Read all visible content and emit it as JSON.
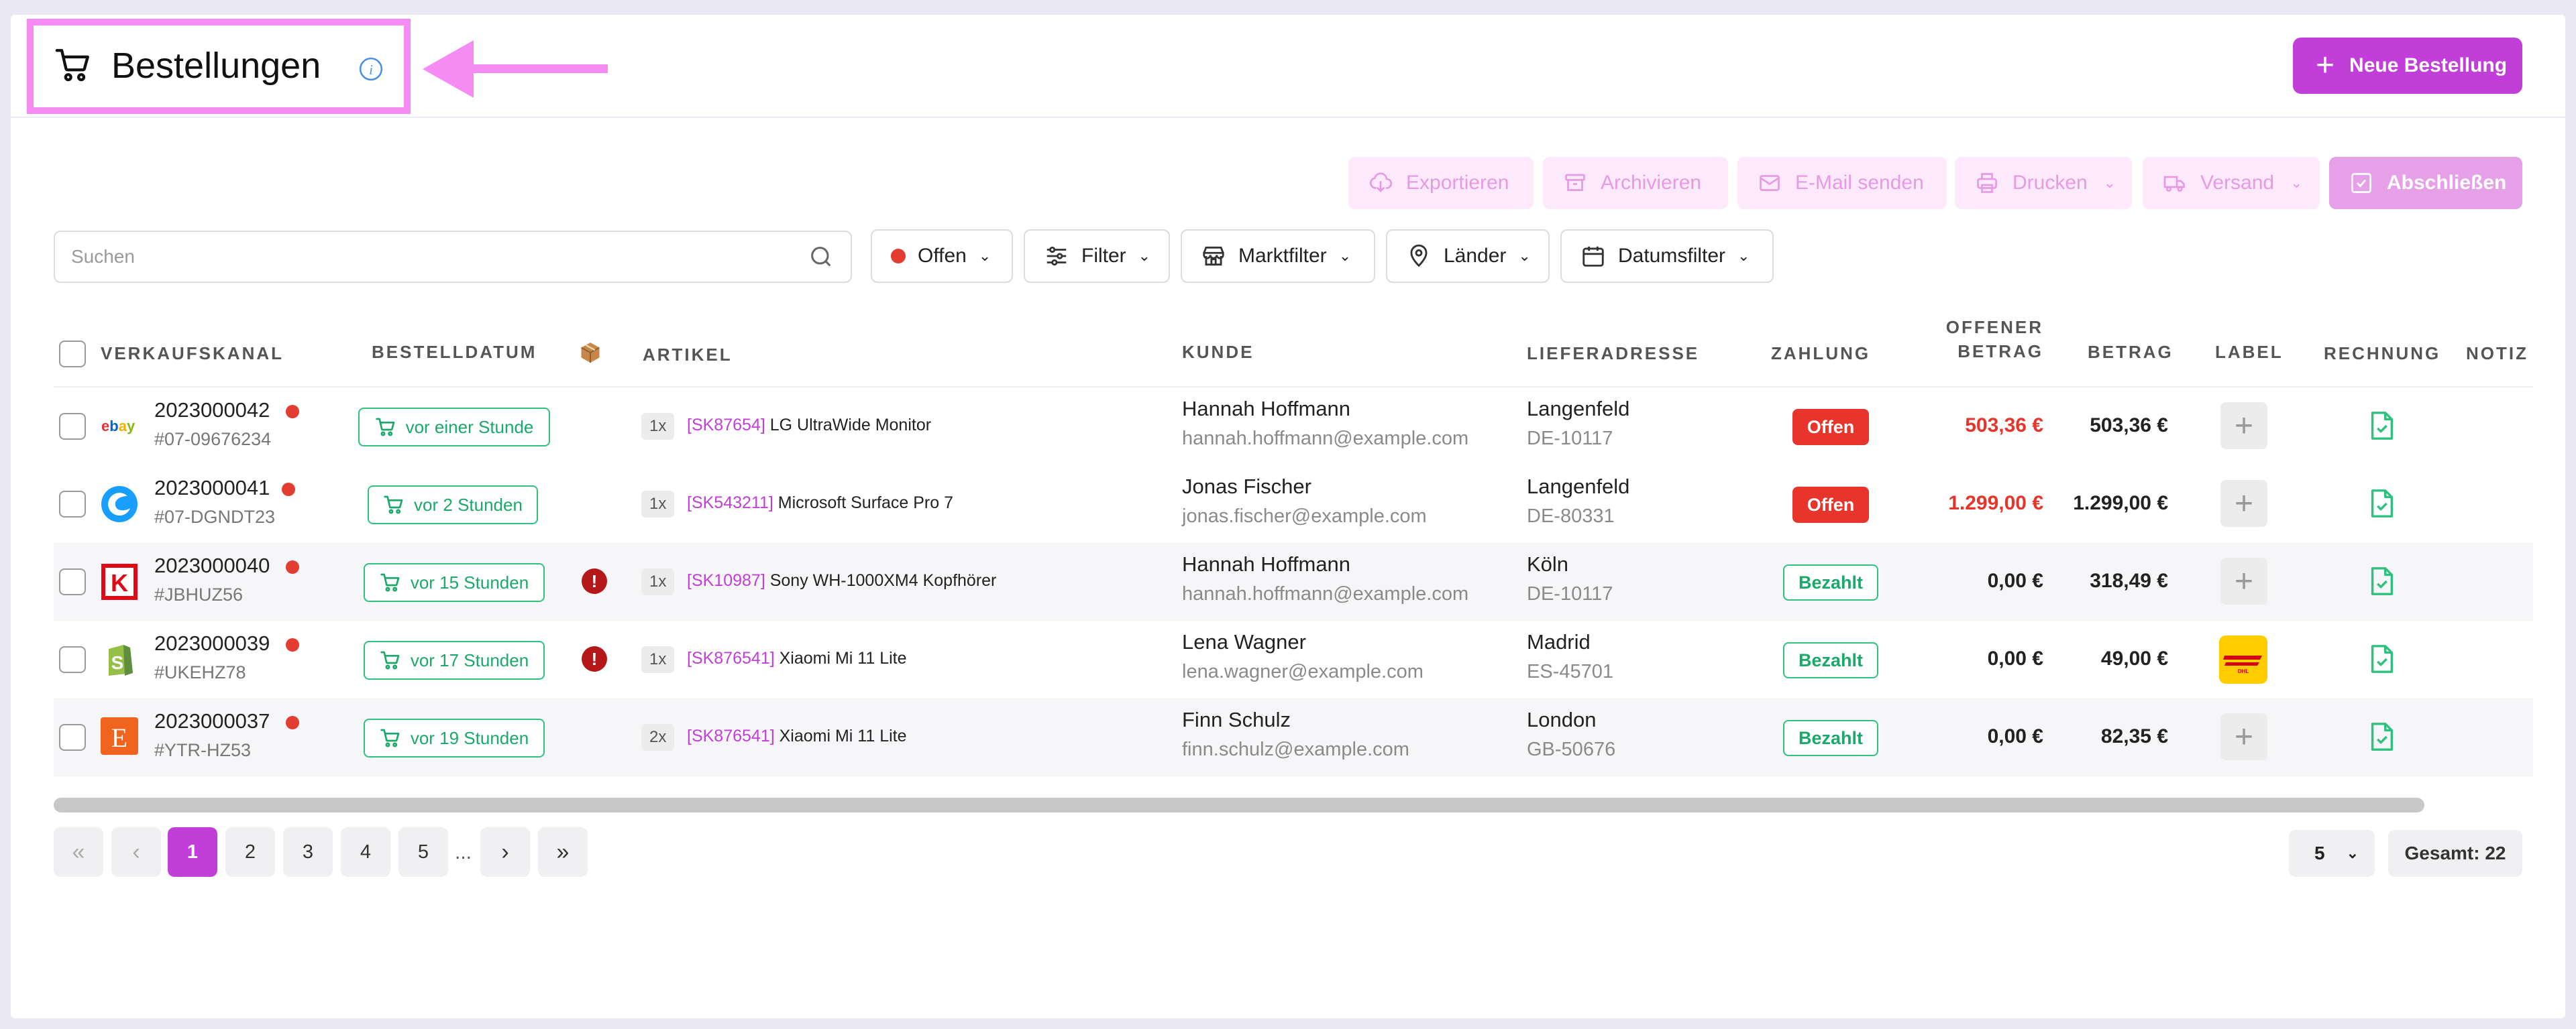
{
  "header": {
    "title": "Bestellungen",
    "new_order_label": "Neue Bestellung",
    "highlight_color": "#f58cf3",
    "accent_color": "#c13fd8"
  },
  "toolbar": {
    "export": "Exportieren",
    "archive": "Archivieren",
    "email": "E-Mail senden",
    "print": "Drucken",
    "shipping": "Versand",
    "complete": "Abschließen"
  },
  "filters": {
    "search_placeholder": "Suchen",
    "status": "Offen",
    "filter": "Filter",
    "market": "Marktfilter",
    "countries": "Länder",
    "date": "Datumsfilter"
  },
  "table": {
    "columns": {
      "channel": "VERKAUFSKANAL",
      "date": "BESTELLDATUM",
      "article": "ARTIKEL",
      "customer": "KUNDE",
      "address": "LIEFERADRESSE",
      "payment": "ZAHLUNG",
      "open_amount_1": "OFFENER",
      "open_amount_2": "BETRAG",
      "amount": "BETRAG",
      "label": "LABEL",
      "invoice": "RECHNUNG",
      "note": "NOTIZ"
    },
    "rows": [
      {
        "channel_icon": "ebay-logo",
        "order": "2023000042",
        "ref": "#07-09676234",
        "date": "vor einer Stunde",
        "warning": false,
        "qty": "1x",
        "sku": "[SK87654]",
        "product": "LG UltraWide Monitor",
        "name": "Hannah Hoffmann",
        "email": "hannah.hoffmann@example.com",
        "city": "Langenfeld",
        "zip": "DE-10117",
        "payment": "Offen",
        "open": "503,36 €",
        "amount": "503,36 €",
        "label": "add"
      },
      {
        "channel_icon": "shopware-logo",
        "order": "2023000041",
        "ref": "#07-DGNDT23",
        "date": "vor 2 Stunden",
        "warning": false,
        "qty": "1x",
        "sku": "[SK543211]",
        "product": "Microsoft Surface Pro 7",
        "name": "Jonas Fischer",
        "email": "jonas.fischer@example.com",
        "city": "Langenfeld",
        "zip": "DE-80331",
        "payment": "Offen",
        "open": "1.299,00 €",
        "amount": "1.299,00 €",
        "label": "add"
      },
      {
        "channel_icon": "kaufland-logo",
        "order": "2023000040",
        "ref": "#JBHUZ56",
        "date": "vor 15 Stunden",
        "warning": true,
        "qty": "1x",
        "sku": "[SK10987]",
        "product": "Sony WH-1000XM4 Kopfhörer",
        "name": "Hannah Hoffmann",
        "email": "hannah.hoffmann@example.com",
        "city": "Köln",
        "zip": "DE-10117",
        "payment": "Bezahlt",
        "open": "0,00 €",
        "amount": "318,49 €",
        "label": "add"
      },
      {
        "channel_icon": "shopify-logo",
        "order": "2023000039",
        "ref": "#UKEHZ78",
        "date": "vor 17 Stunden",
        "warning": true,
        "qty": "1x",
        "sku": "[SK876541]",
        "product": "Xiaomi Mi 11 Lite",
        "name": "Lena Wagner",
        "email": "lena.wagner@example.com",
        "city": "Madrid",
        "zip": "ES-45701",
        "payment": "Bezahlt",
        "open": "0,00 €",
        "amount": "49,00 €",
        "label": "dhl"
      },
      {
        "channel_icon": "etsy-logo",
        "order": "2023000037",
        "ref": "#YTR-HZ53",
        "date": "vor 19 Stunden",
        "warning": false,
        "qty": "2x",
        "sku": "[SK876541]",
        "product": "Xiaomi Mi 11 Lite",
        "name": "Finn Schulz",
        "email": "finn.schulz@example.com",
        "city": "London",
        "zip": "GB-50676",
        "payment": "Bezahlt",
        "open": "0,00 €",
        "amount": "82,35 €",
        "label": "add"
      }
    ]
  },
  "pagination": {
    "pages": [
      "1",
      "2",
      "3",
      "4",
      "5"
    ],
    "current": "1",
    "ellipsis": "...",
    "page_size": "5",
    "total": "Gesamt: 22"
  }
}
